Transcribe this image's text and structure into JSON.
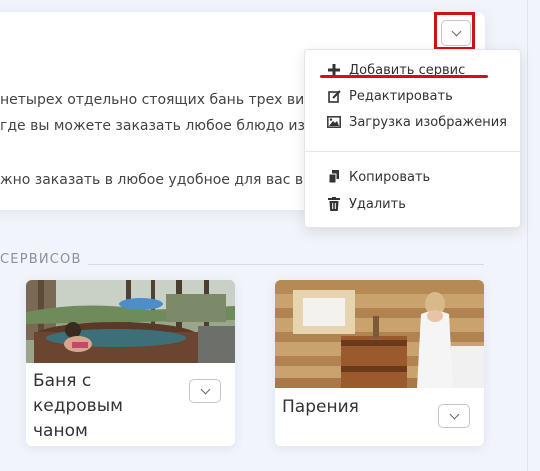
{
  "info_card": {
    "lines": [
      "нетырех отдельно стоящих бань трех видо",
      "где вы можете заказать любое блюдо из е",
      "жно заказать в любое удобное для вас вр"
    ]
  },
  "menu": {
    "items": [
      {
        "label": "Добавить сервис",
        "icon": "plus-icon"
      },
      {
        "label": "Редактировать",
        "icon": "edit-icon"
      },
      {
        "label": "Загрузка изображения",
        "icon": "image-icon"
      },
      {
        "label": "Копировать",
        "icon": "copy-icon"
      },
      {
        "label": "Удалить",
        "icon": "trash-icon"
      }
    ]
  },
  "section": {
    "title": "СЕРВИСОВ"
  },
  "services": [
    {
      "title_lines": [
        "Баня с",
        "кедровым",
        "чаном"
      ],
      "image": "outdoor-hot-tub-photo"
    },
    {
      "title_lines": [
        "Парения"
      ],
      "image": "sauna-barrel-photo"
    }
  ],
  "colors": {
    "highlight": "#d01216",
    "background": "#f1f4fa"
  }
}
